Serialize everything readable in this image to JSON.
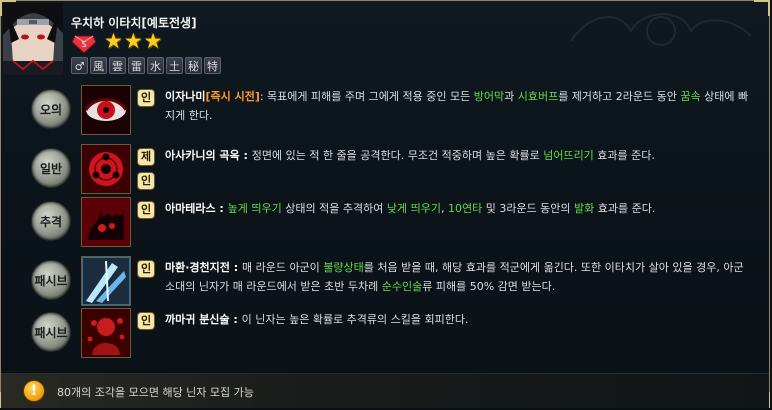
{
  "character": {
    "name": "우치하 이타치[예토전생]",
    "star_count": 3,
    "stars": [
      "★",
      "★",
      "★"
    ],
    "attributes": [
      "♂",
      "風",
      "雲",
      "雷",
      "水",
      "土",
      "秘",
      "特"
    ]
  },
  "skills": [
    {
      "type": "오의",
      "tags": [
        "인"
      ],
      "parts": [
        {
          "text": "이자나미",
          "style": "name"
        },
        {
          "text": "[즉시 시전]",
          "style": "orange"
        },
        {
          "text": ": 목표에게 피해를 주며 그에게 적용 중인 모든 ",
          "style": "normal"
        },
        {
          "text": "방어막",
          "style": "green"
        },
        {
          "text": "과 ",
          "style": "normal"
        },
        {
          "text": "시효버프",
          "style": "green"
        },
        {
          "text": "를 제거하고 2라운드 동안 ",
          "style": "normal"
        },
        {
          "text": "꿈속",
          "style": "green"
        },
        {
          "text": " 상태에 빠지게 한다.",
          "style": "normal"
        }
      ]
    },
    {
      "type": "일반",
      "tags": [
        "제",
        "인"
      ],
      "parts": [
        {
          "text": "아사카니의 곡옥 : ",
          "style": "name"
        },
        {
          "text": "정면에 있는 적 한 줄을 공격한다. 무조건 적중하며 높은 확률로 ",
          "style": "normal"
        },
        {
          "text": "넘어뜨리기",
          "style": "green"
        },
        {
          "text": " 효과를 준다.",
          "style": "normal"
        }
      ]
    },
    {
      "type": "추격",
      "tags": [
        "인"
      ],
      "parts": [
        {
          "text": "아마테라스 : ",
          "style": "name"
        },
        {
          "text": "높게 띄우기",
          "style": "green"
        },
        {
          "text": " 상태의 적을 추격하여 ",
          "style": "normal"
        },
        {
          "text": "낮게 띄우기",
          "style": "green"
        },
        {
          "text": ", ",
          "style": "normal"
        },
        {
          "text": "10연타",
          "style": "green"
        },
        {
          "text": " 및 3라운드 동안의 ",
          "style": "normal"
        },
        {
          "text": "발화",
          "style": "green"
        },
        {
          "text": " 효과를 준다.",
          "style": "normal"
        }
      ]
    },
    {
      "type": "패시브",
      "tags": [
        "인"
      ],
      "parts": [
        {
          "text": "마환·경천지전 : ",
          "style": "name"
        },
        {
          "text": "매 라운드 아군이 ",
          "style": "normal"
        },
        {
          "text": "불량상태",
          "style": "green"
        },
        {
          "text": "를 처음 받을 때, 해당 효과를 적군에게 옮긴다. 또한 이타치가 살아 있을 경우, 아군 소대의 닌자가 매 라운드에서 받은 초반 두차례 ",
          "style": "normal"
        },
        {
          "text": "순수인술",
          "style": "green"
        },
        {
          "text": "류 피해를 50% 감면 받는다.",
          "style": "normal"
        }
      ]
    },
    {
      "type": "패시브",
      "tags": [
        "인"
      ],
      "parts": [
        {
          "text": "까마귀 분신술 : ",
          "style": "name"
        },
        {
          "text": "이 닌자는 높은 확률로 추격류의 스킬을 회피한다.",
          "style": "normal"
        }
      ]
    }
  ],
  "footer": {
    "alert_glyph": "!",
    "text": "80개의 조각을 모으면 해당 닌자 모집 가능"
  }
}
